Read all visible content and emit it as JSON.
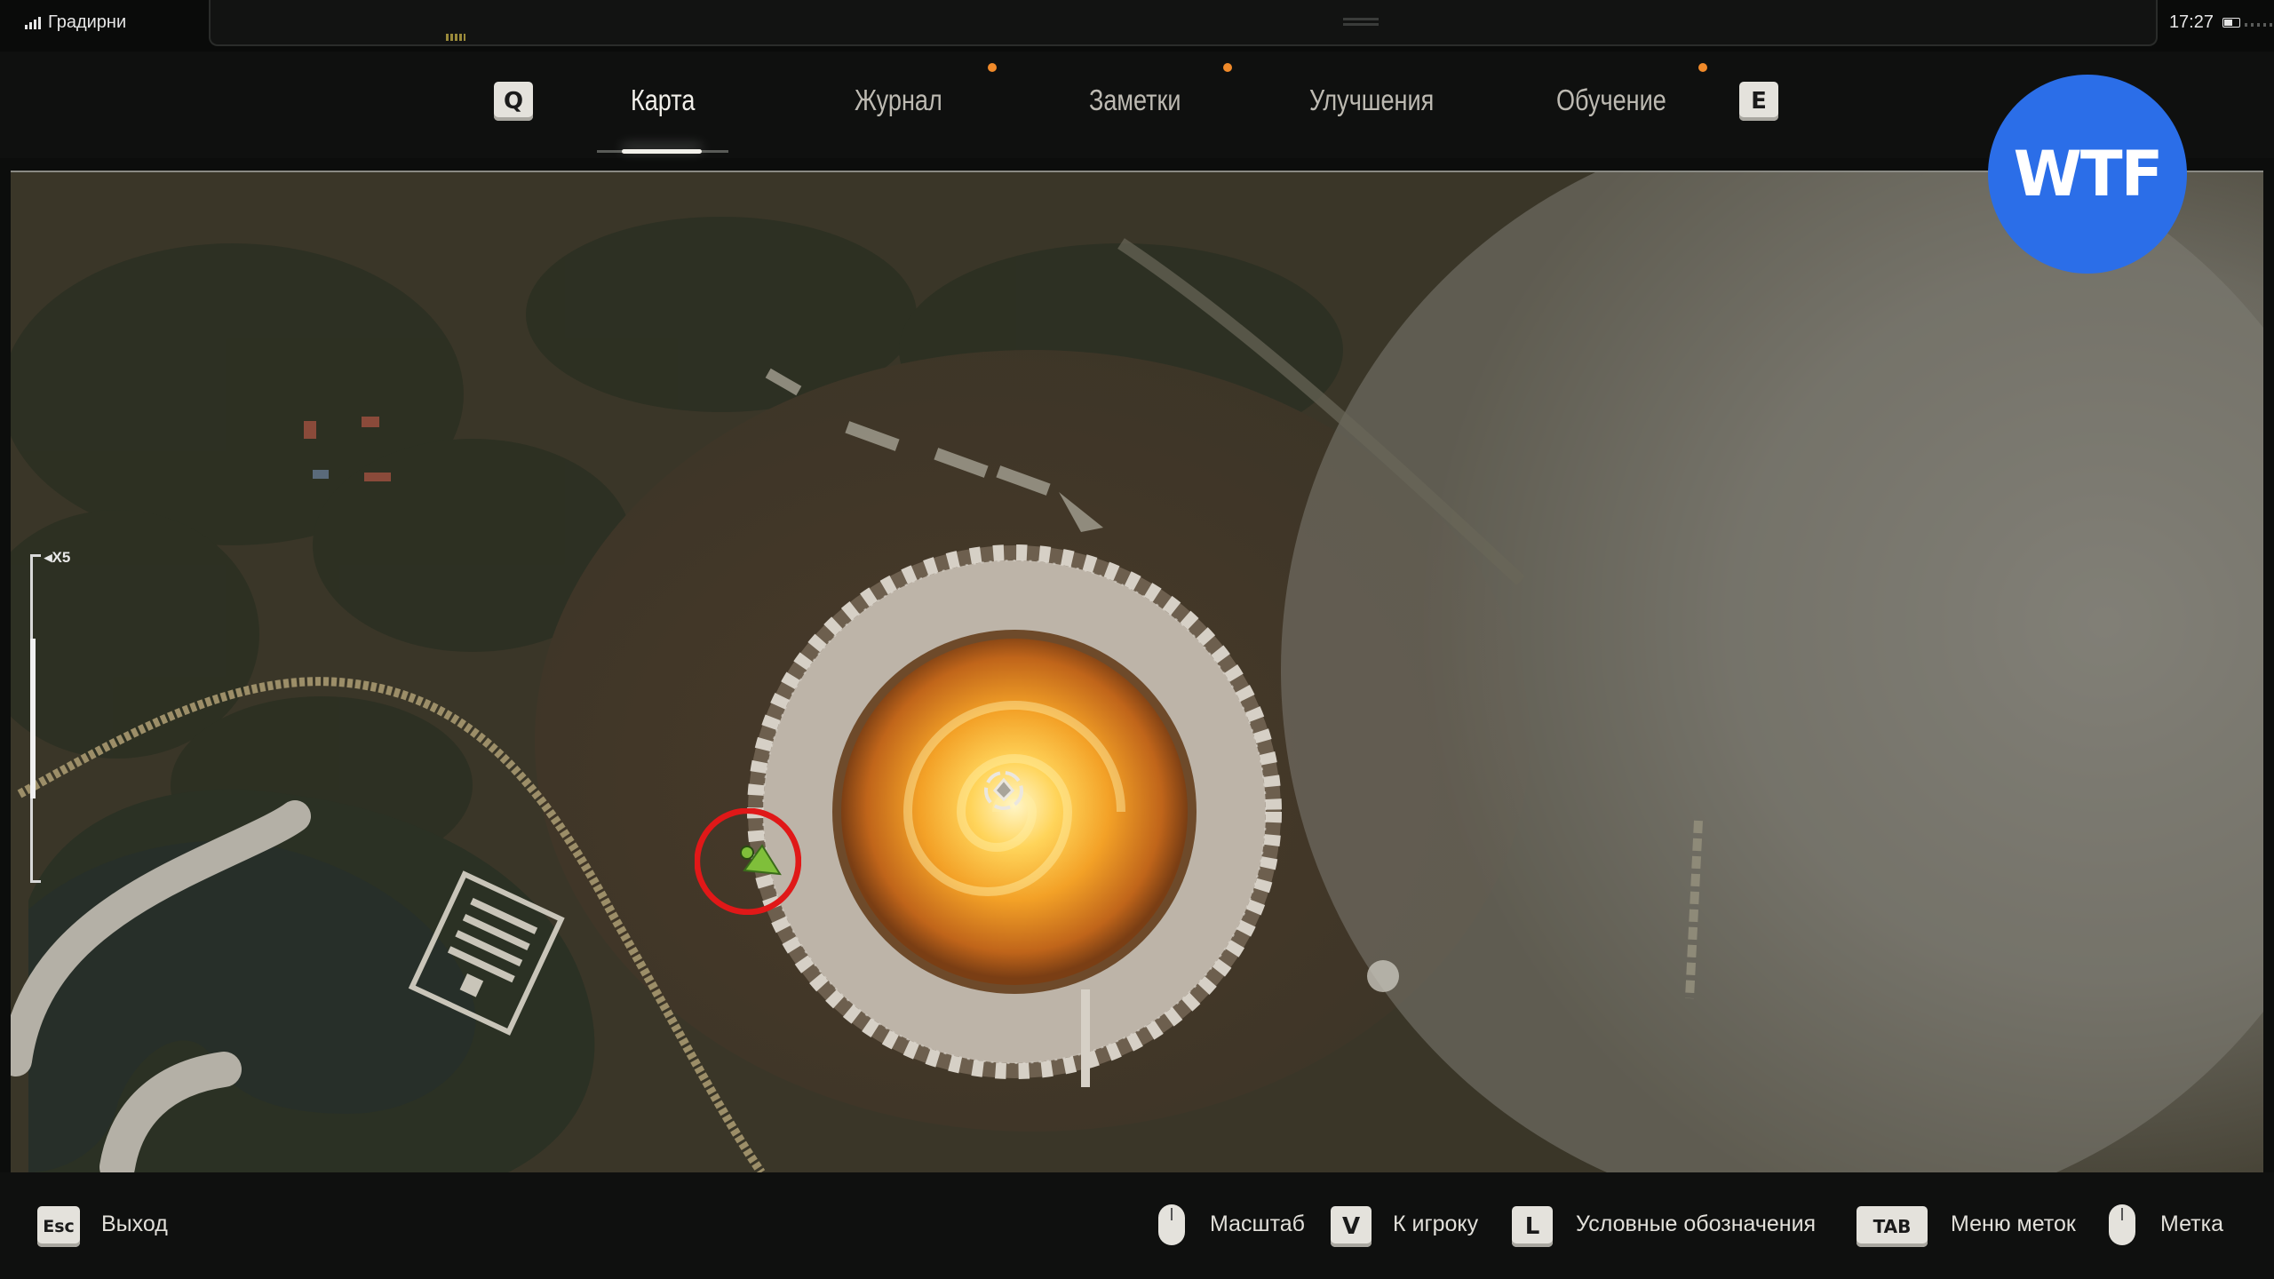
{
  "status_bar": {
    "location": "Градирни",
    "time": "17:27",
    "icons": [
      "signal-icon",
      "battery-icon"
    ]
  },
  "tabs": {
    "prev_key": "Q",
    "next_key": "E",
    "items": [
      {
        "label": "Карта",
        "active": true,
        "notification": false
      },
      {
        "label": "Журнал",
        "active": false,
        "notification": true
      },
      {
        "label": "Заметки",
        "active": false,
        "notification": true
      },
      {
        "label": "Улучшения",
        "active": false,
        "notification": true
      },
      {
        "label": "Обучение",
        "active": false,
        "notification": false
      }
    ],
    "notification_color": "#f08a2a"
  },
  "watermark": "WTF",
  "map": {
    "zoom_label": "X5",
    "markers": [
      "player-marker-icon",
      "anomaly-marker-icon"
    ],
    "highlight_color": "#e01818"
  },
  "bottom_hints": {
    "exit": {
      "key": "Esc",
      "label": "Выход"
    },
    "zoom": {
      "icon": "mouse-scroll-icon",
      "label": "Масштаб"
    },
    "to_player": {
      "key": "V",
      "label": "К игроку"
    },
    "legend": {
      "key": "L",
      "label": "Условные обозначения"
    },
    "marks_menu": {
      "key": "TAB",
      "label": "Меню меток"
    },
    "mark": {
      "icon": "mouse-click-icon",
      "label": "Метка"
    }
  }
}
